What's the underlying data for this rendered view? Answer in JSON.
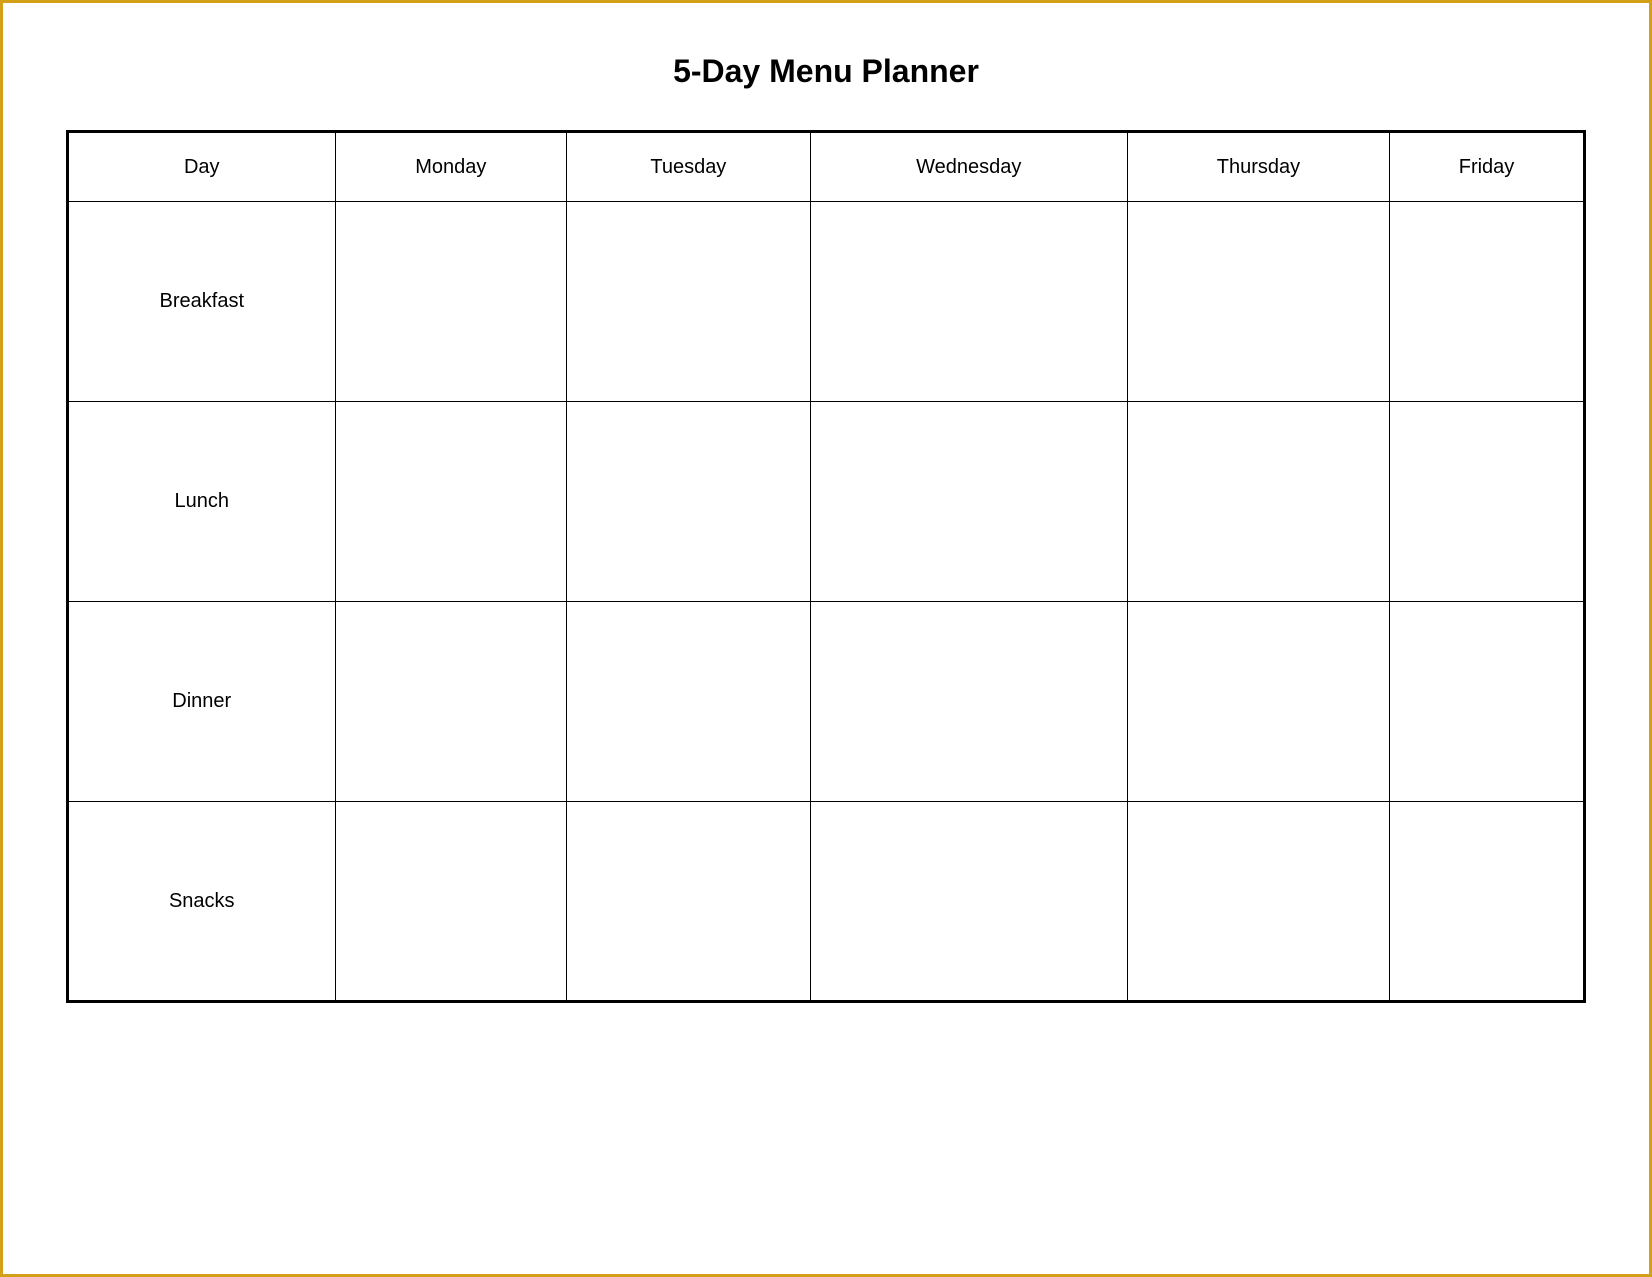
{
  "title": "5-Day Menu Planner",
  "table": {
    "headers": [
      {
        "id": "day",
        "label": "Day"
      },
      {
        "id": "monday",
        "label": "Monday"
      },
      {
        "id": "tuesday",
        "label": "Tuesday"
      },
      {
        "id": "wednesday",
        "label": "Wednesday"
      },
      {
        "id": "thursday",
        "label": "Thursday"
      },
      {
        "id": "friday",
        "label": "Friday"
      }
    ],
    "rows": [
      {
        "id": "breakfast",
        "label": "Breakfast"
      },
      {
        "id": "lunch",
        "label": "Lunch"
      },
      {
        "id": "dinner",
        "label": "Dinner"
      },
      {
        "id": "snacks",
        "label": "Snacks"
      }
    ]
  }
}
